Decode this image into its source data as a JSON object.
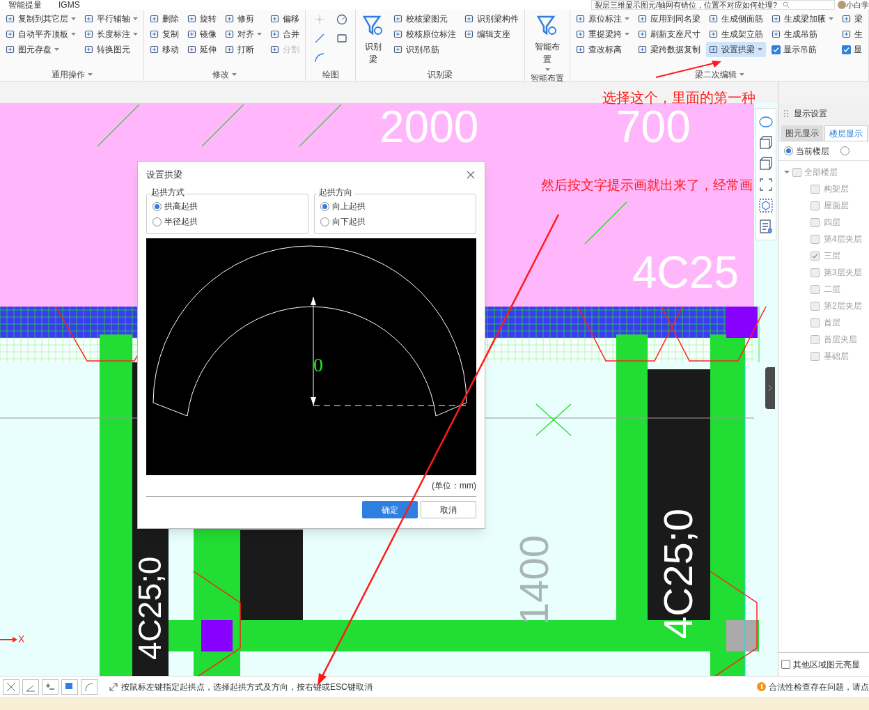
{
  "menu_tabs": [
    "智能提量",
    "IGMS"
  ],
  "search": {
    "value": "裂层三维显示图元/轴网有错位，位置不对应如何处理?"
  },
  "user": {
    "name": "小白学"
  },
  "ribbon": [
    {
      "label": "通用操作",
      "columns": [
        [
          {
            "label": "复制到其它层",
            "kind": "menu"
          },
          {
            "label": "自动平齐顶板",
            "kind": "menu"
          },
          {
            "label": "图元存盘",
            "kind": "menu"
          }
        ],
        [
          {
            "label": "平行辅轴",
            "kind": "menu"
          },
          {
            "label": "长度标注",
            "kind": "menu"
          },
          {
            "label": "转换图元",
            "kind": "tool"
          }
        ]
      ]
    },
    {
      "label": "修改",
      "columns": [
        [
          {
            "label": "删除",
            "kind": "tool"
          },
          {
            "label": "复制",
            "kind": "tool"
          },
          {
            "label": "移动",
            "kind": "tool"
          }
        ],
        [
          {
            "label": "旋转",
            "kind": "tool"
          },
          {
            "label": "镜像",
            "kind": "tool"
          },
          {
            "label": "延伸",
            "kind": "tool"
          }
        ],
        [
          {
            "label": "修剪",
            "kind": "tool"
          },
          {
            "label": "对齐",
            "kind": "menu"
          },
          {
            "label": "打断",
            "kind": "tool"
          }
        ],
        [
          {
            "label": "偏移",
            "kind": "tool"
          },
          {
            "label": "合并",
            "kind": "tool"
          },
          {
            "label": "分割",
            "kind": "disabled"
          }
        ]
      ]
    },
    {
      "label": "绘图"
    },
    {
      "label": "识别梁",
      "columns": [
        [
          {
            "label": "识别梁",
            "kind": "big"
          }
        ],
        [
          {
            "label": "校核梁图元",
            "kind": "tool"
          },
          {
            "label": "校核原位标注",
            "kind": "tool"
          },
          {
            "label": "识别吊筋",
            "kind": "tool"
          }
        ],
        [
          {
            "label": "识别梁构件",
            "kind": "tool"
          },
          {
            "label": "编辑支座",
            "kind": "tool"
          }
        ]
      ]
    },
    {
      "label": "智能布置",
      "columns": [
        [
          {
            "label": "智能布置",
            "kind": "bigmenu"
          }
        ]
      ]
    },
    {
      "label": "梁二次编辑",
      "columns": [
        [
          {
            "label": "原位标注",
            "kind": "menu"
          },
          {
            "label": "重提梁跨",
            "kind": "menu"
          },
          {
            "label": "查改标高",
            "kind": "tool"
          }
        ],
        [
          {
            "label": "应用到同名梁",
            "kind": "tool"
          },
          {
            "label": "刷新支座尺寸",
            "kind": "tool"
          },
          {
            "label": "梁跨数据复制",
            "kind": "tool"
          }
        ],
        [
          {
            "label": "生成侧面筋",
            "kind": "tool"
          },
          {
            "label": "生成架立筋",
            "kind": "tool"
          },
          {
            "label": "设置拱梁",
            "kind": "active"
          }
        ],
        [
          {
            "label": "生成梁加腋",
            "kind": "menu"
          },
          {
            "label": "生成吊筋",
            "kind": "tool"
          },
          {
            "label": "显示吊筋",
            "kind": "checkbox",
            "checked": true
          }
        ],
        [
          {
            "label": "梁",
            "kind": "tool"
          },
          {
            "label": "生",
            "kind": "tool"
          },
          {
            "label": "显",
            "kind": "checkbox",
            "checked": true
          }
        ]
      ]
    }
  ],
  "canvas": {
    "labels": [
      {
        "text": "2000",
        "kind": "horizontal"
      },
      {
        "text": "700",
        "kind": "horizontal"
      },
      {
        "text": "4C25",
        "kind": "horizontal"
      },
      {
        "text": "4C25;0",
        "kind": "vertical"
      },
      {
        "text": "1400",
        "kind": "vertical"
      },
      {
        "text": "4C25;0",
        "kind": "vertical"
      }
    ],
    "axis": "X"
  },
  "annotations": [
    "选择这个，里面的第一种",
    "然后按文字提示画就出来了，经常画"
  ],
  "dialog": {
    "title": "设置拱梁",
    "groups": [
      {
        "title": "起拱方式",
        "options": [
          {
            "label": "拱高起拱",
            "selected": true
          },
          {
            "label": "半径起拱",
            "selected": false
          }
        ]
      },
      {
        "title": "起拱方向",
        "options": [
          {
            "label": "向上起拱",
            "selected": true
          },
          {
            "label": "向下起拱",
            "selected": false
          }
        ]
      }
    ],
    "preview_value": "0",
    "unit": "(单位：mm)",
    "buttons": [
      {
        "label": "确定",
        "primary": true
      },
      {
        "label": "取消",
        "primary": false
      }
    ]
  },
  "panel": {
    "title": "显示设置",
    "tabs": [
      {
        "label": "图元显示",
        "selected": false
      },
      {
        "label": "楼层显示",
        "selected": true
      }
    ],
    "scope": [
      {
        "label": "当前楼层",
        "selected": true
      },
      {
        "selected": false
      }
    ],
    "tree": {
      "label": "全部楼层",
      "expanded": true,
      "checked": false,
      "children": [
        {
          "label": "构架层",
          "checked": false
        },
        {
          "label": "屋面层",
          "checked": false
        },
        {
          "label": "四层",
          "checked": false
        },
        {
          "label": "第4层夹层",
          "checked": false
        },
        {
          "label": "三层",
          "checked": true
        },
        {
          "label": "第3层夹层",
          "checked": false
        },
        {
          "label": "二层",
          "checked": false
        },
        {
          "label": "第2层夹层",
          "checked": false
        },
        {
          "label": "首层",
          "checked": false
        },
        {
          "label": "首层夹层",
          "checked": false
        },
        {
          "label": "基础层",
          "checked": false
        }
      ]
    },
    "highlight_other": {
      "label": "其他区域图元亮显",
      "checked": false
    }
  },
  "status": {
    "hint": "按鼠标左键指定起拱点，选择起拱方式及方向，按右键或ESC键取消",
    "warning": "合法性检查存在问题，请点"
  }
}
